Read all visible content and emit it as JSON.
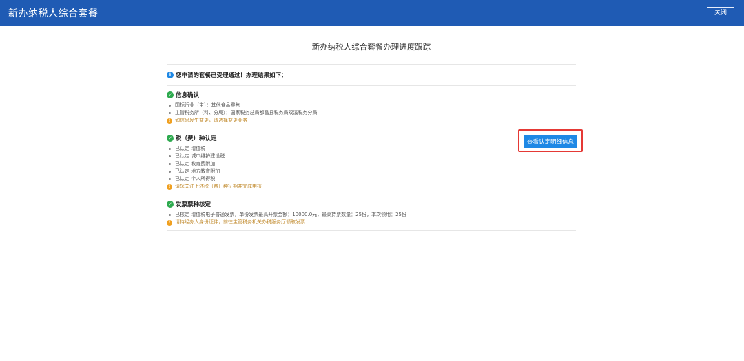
{
  "header": {
    "title": "新办纳税人综合套餐",
    "close_label": "关闭"
  },
  "page": {
    "title": "新办纳税人综合套餐办理进度跟踪",
    "notice": "您申请的套餐已受理通过！办理结果如下："
  },
  "sections": [
    {
      "title": "信息确认",
      "items": [
        "国标行业（主）：其他食品零售",
        "主管税务所（科、分局）：国家税务总局都昌县税务局双溪税务分局"
      ],
      "warn": "如信息发生变更，请选择变更业务"
    },
    {
      "title": "税（费）种认定",
      "items": [
        "已认定 增值税",
        "已认定 城市维护建设税",
        "已认定 教育费附加",
        "已认定 地方教育附加",
        "已认定 个人所得税"
      ],
      "warn": "请您关注上述税（费）种征期并完成申报",
      "button": "查看认定明细信息"
    },
    {
      "title": "发票票种核定",
      "items": [
        "已核定 增值税电子普通发票，单份发票最高开票金额：10000.0元，最高持票数量：25份，本次领用：25份"
      ],
      "warn": "请持经办人身份证件，前往主管税务机关办税服务厅领取发票"
    }
  ],
  "icons": {
    "info": "info-icon",
    "check": "check-circle-icon",
    "warn": "warning-icon"
  },
  "colors": {
    "header": "#1f5bb4",
    "button": "#1e88e5",
    "highlight": "#e53935",
    "success": "#2eaa4f",
    "warning": "#f0a020"
  }
}
